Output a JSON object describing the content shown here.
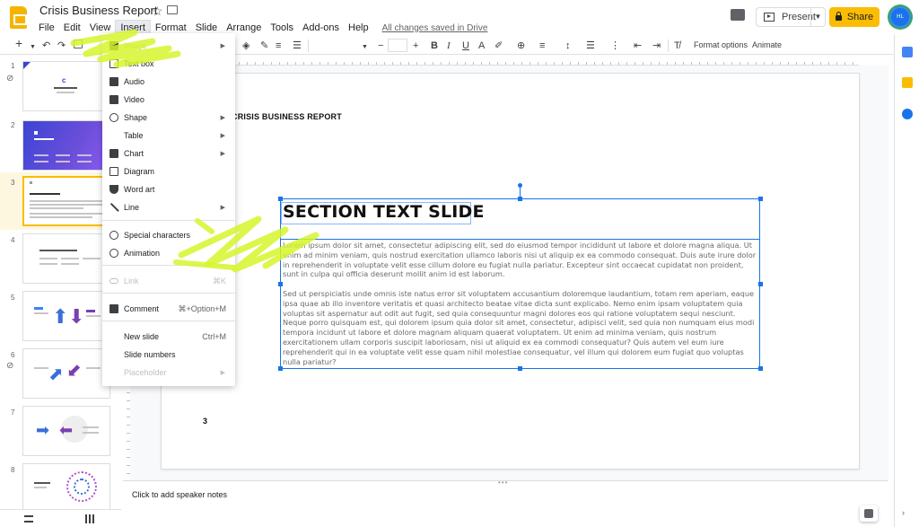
{
  "header": {
    "title": "Crisis Business Report",
    "save_status": "All changes saved in Drive",
    "present_label": "Present",
    "share_label": "Share",
    "avatar_initials": "HL"
  },
  "menubar": [
    "File",
    "Edit",
    "View",
    "Insert",
    "Format",
    "Slide",
    "Arrange",
    "Tools",
    "Add-ons",
    "Help"
  ],
  "toolbar": {
    "add": "+",
    "undo": "↶",
    "redo": "↷",
    "decrease_font": "−",
    "increase_font": "+",
    "bold": "B",
    "italic": "I",
    "underline": "U",
    "format_options": "Format options",
    "animate": "Animate"
  },
  "filmstrip": {
    "slides": [
      "1",
      "2",
      "3",
      "4",
      "5",
      "6",
      "7",
      "8"
    ]
  },
  "insert_menu": {
    "items": [
      {
        "label": "Image",
        "icon": "image-icon",
        "submenu": true,
        "disabled": false
      },
      {
        "label": "Text box",
        "icon": "text-box-icon",
        "submenu": false,
        "disabled": false
      },
      {
        "label": "Audio",
        "icon": "audio-icon",
        "submenu": false,
        "disabled": false
      },
      {
        "label": "Video",
        "icon": "video-icon",
        "submenu": false,
        "disabled": false
      },
      {
        "label": "Shape",
        "icon": "shape-icon",
        "submenu": true,
        "disabled": false
      },
      {
        "label": "Table",
        "icon": "",
        "submenu": true,
        "disabled": false
      },
      {
        "label": "Chart",
        "icon": "chart-icon",
        "submenu": true,
        "disabled": false
      },
      {
        "label": "Diagram",
        "icon": "diagram-icon",
        "submenu": false,
        "disabled": false
      },
      {
        "label": "Word art",
        "icon": "word-art-icon",
        "submenu": false,
        "disabled": false
      },
      {
        "label": "Line",
        "icon": "line-icon",
        "submenu": true,
        "disabled": false
      },
      {
        "label": "Special characters",
        "icon": "omega-icon",
        "submenu": false,
        "disabled": false
      },
      {
        "label": "Animation",
        "icon": "animation-icon",
        "submenu": false,
        "disabled": false
      },
      {
        "label": "Link",
        "icon": "link-icon",
        "shortcut": "⌘K",
        "submenu": false,
        "disabled": true
      },
      {
        "label": "Comment",
        "icon": "comment-icon",
        "shortcut": "⌘+Option+M",
        "submenu": false,
        "disabled": false
      },
      {
        "label": "New slide",
        "icon": "",
        "shortcut": "Ctrl+M",
        "submenu": false,
        "disabled": false
      },
      {
        "label": "Slide numbers",
        "icon": "",
        "submenu": false,
        "disabled": false
      },
      {
        "label": "Placeholder",
        "icon": "",
        "submenu": true,
        "disabled": true
      }
    ]
  },
  "slide": {
    "header": "CRISIS BUSINESS REPORT",
    "title": "SECTION TEXT SLIDE",
    "paragraphs": [
      "Lorem ipsum dolor sit amet, consectetur adipiscing elit, sed do eiusmod tempor incididunt ut labore et dolore magna aliqua. Ut enim ad minim veniam, quis nostrud exercitation ullamco laboris nisi ut aliquip ex ea commodo consequat. Duis aute irure dolor in reprehenderit in voluptate velit esse cillum dolore eu fugiat nulla pariatur. Excepteur sint occaecat cupidatat non proident, sunt in culpa qui officia deserunt mollit anim id est laborum.",
      "Sed ut perspiciatis unde omnis iste natus error sit voluptatem accusantium doloremque laudantium, totam rem aperiam, eaque ipsa quae ab illo inventore veritatis et quasi architecto beatae vitae dicta sunt explicabo. Nemo enim ipsam voluptatem quia voluptas sit aspernatur aut odit aut fugit, sed quia consequuntur magni dolores eos qui ratione voluptatem sequi nesciunt. Neque porro quisquam est, qui dolorem ipsum quia dolor sit amet, consectetur, adipisci velit, sed quia non numquam eius modi tempora incidunt ut labore et dolore magnam aliquam quaerat voluptatem. Ut enim ad minima veniam, quis nostrum exercitationem ullam corporis suscipit laboriosam, nisi ut aliquid ex ea commodi consequatur? Quis autem vel eum iure reprehenderit qui in ea voluptate velit esse quam nihil molestiae consequatur, vel illum qui dolorem eum fugiat quo voluptas nulla pariatur?"
    ],
    "page_number": "3"
  },
  "notes": {
    "placeholder": "Click to add speaker notes"
  },
  "colors": {
    "accent_yellow": "#fbbc04",
    "selection_blue": "#1a73e8",
    "highlighter": "#d7f52b"
  }
}
